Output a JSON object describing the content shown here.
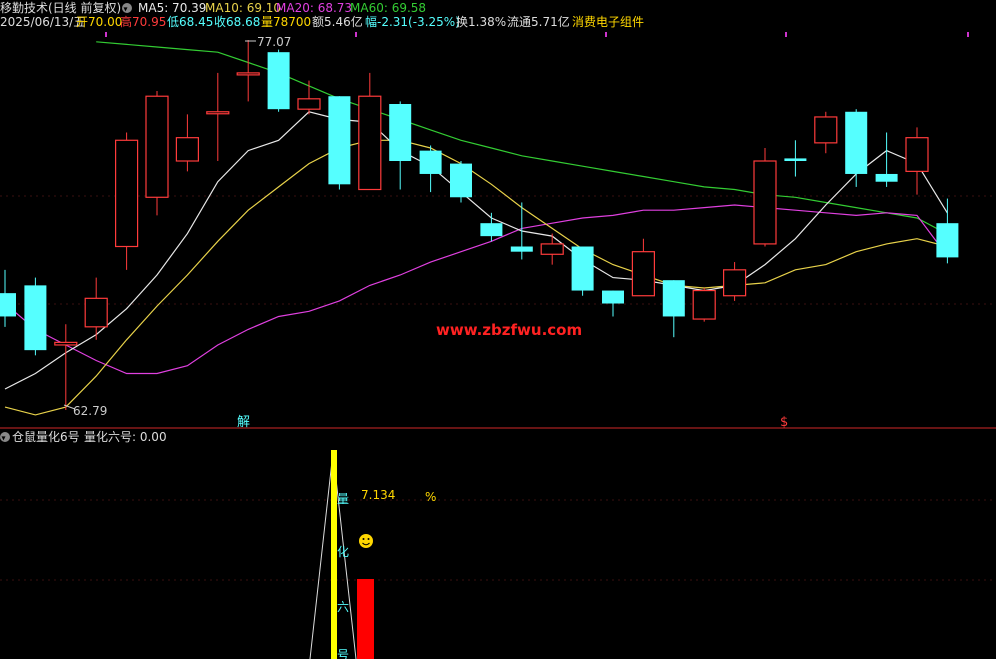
{
  "header": {
    "title": "移勤技术(日线 前复权)",
    "ma5_label": "MA5: 70.39",
    "ma10_label": "MA10: 69.10",
    "ma20_label": "MA20: 68.73",
    "ma60_label": "MA60: 69.58",
    "date": "2025/06/13/五",
    "open": "开70.00",
    "high": "高70.95",
    "low": "低68.45",
    "close": "收68.68",
    "volume": "量78700",
    "amount": "额5.46亿",
    "change": "幅-2.31(-3.25%)",
    "turnover": "换1.38%",
    "float_cap": "流通5.71亿",
    "sector": "消费电子组件"
  },
  "annotations": {
    "high_mark": "77.07",
    "low_mark": "62.79",
    "jie": "解",
    "dollar": "$",
    "watermark": "www.zbzfwu.com"
  },
  "indicator": {
    "title": "仓鼠量化6号",
    "value_label": "量化六号: 0.00",
    "pct_value": "7.134",
    "pct_sign": "%",
    "smiley": "☺",
    "vertical_chars": [
      "量",
      "化",
      "六",
      "号"
    ]
  },
  "colors": {
    "up": "#ff3b3b",
    "down": "#55ffff",
    "ma5": "#e8e8e8",
    "ma10": "#e8d24a",
    "ma20": "#e040e0",
    "ma60": "#33cc33",
    "yellow_text": "#ffd700",
    "red_text": "#ff3b3b",
    "grid": "#7a1c1c"
  },
  "chart_data": {
    "type": "candlestick",
    "candles": [
      {
        "o": 67.3,
        "c": 66.4,
        "h": 68.2,
        "l": 66.0
      },
      {
        "o": 67.6,
        "c": 65.1,
        "h": 67.9,
        "l": 64.9
      },
      {
        "o": 65.3,
        "c": 65.4,
        "h": 66.1,
        "l": 62.79
      },
      {
        "o": 66.0,
        "c": 67.1,
        "h": 67.9,
        "l": 65.5
      },
      {
        "o": 69.1,
        "c": 73.2,
        "h": 73.5,
        "l": 68.2
      },
      {
        "o": 71.0,
        "c": 74.9,
        "h": 75.1,
        "l": 70.3
      },
      {
        "o": 72.4,
        "c": 73.3,
        "h": 74.2,
        "l": 72.0
      },
      {
        "o": 74.3,
        "c": 74.3,
        "h": 75.8,
        "l": 72.4
      },
      {
        "o": 75.8,
        "c": 75.8,
        "h": 77.07,
        "l": 74.7
      },
      {
        "o": 76.6,
        "c": 74.4,
        "h": 76.7,
        "l": 74.3
      },
      {
        "o": 74.4,
        "c": 74.8,
        "h": 75.5,
        "l": 74.2
      },
      {
        "o": 74.9,
        "c": 71.5,
        "h": 74.9,
        "l": 71.3
      },
      {
        "o": 71.3,
        "c": 74.9,
        "h": 75.8,
        "l": 71.3
      },
      {
        "o": 74.6,
        "c": 72.4,
        "h": 74.7,
        "l": 71.3
      },
      {
        "o": 72.8,
        "c": 71.9,
        "h": 73.0,
        "l": 71.2
      },
      {
        "o": 72.3,
        "c": 71.0,
        "h": 72.4,
        "l": 70.8
      },
      {
        "o": 70.0,
        "c": 69.5,
        "h": 70.4,
        "l": 69.3
      },
      {
        "o": 69.1,
        "c": 68.9,
        "h": 70.8,
        "l": 68.6
      },
      {
        "o": 68.8,
        "c": 69.2,
        "h": 69.6,
        "l": 68.4
      },
      {
        "o": 69.1,
        "c": 67.4,
        "h": 69.1,
        "l": 67.2
      },
      {
        "o": 67.4,
        "c": 66.9,
        "h": 67.4,
        "l": 66.4
      },
      {
        "o": 67.2,
        "c": 68.9,
        "h": 69.4,
        "l": 67.2
      },
      {
        "o": 67.8,
        "c": 66.4,
        "h": 67.8,
        "l": 65.6
      },
      {
        "o": 66.3,
        "c": 67.4,
        "h": 67.5,
        "l": 66.2
      },
      {
        "o": 67.2,
        "c": 68.2,
        "h": 68.5,
        "l": 67.0
      },
      {
        "o": 69.2,
        "c": 72.4,
        "h": 72.9,
        "l": 69.1
      },
      {
        "o": 72.5,
        "c": 72.4,
        "h": 73.2,
        "l": 71.8
      },
      {
        "o": 73.1,
        "c": 74.1,
        "h": 74.3,
        "l": 72.7
      },
      {
        "o": 74.3,
        "c": 71.9,
        "h": 74.4,
        "l": 71.4
      },
      {
        "o": 71.9,
        "c": 71.6,
        "h": 73.5,
        "l": 71.4
      },
      {
        "o": 72.0,
        "c": 73.3,
        "h": 73.7,
        "l": 71.1
      },
      {
        "o": 70.0,
        "c": 68.68,
        "h": 70.95,
        "l": 68.45
      }
    ],
    "ma5": [
      63.6,
      64.2,
      65.0,
      65.7,
      66.7,
      68.0,
      69.6,
      71.6,
      72.8,
      73.2,
      74.3,
      74.0,
      73.9,
      72.8,
      72.2,
      71.2,
      70.2,
      69.7,
      69.5,
      68.6,
      67.9,
      67.8,
      67.6,
      67.4,
      67.6,
      68.4,
      69.4,
      70.7,
      71.9,
      72.8,
      72.3,
      70.39
    ],
    "ma10": [
      62.9,
      62.6,
      62.9,
      64.1,
      65.5,
      66.8,
      68.0,
      69.3,
      70.5,
      71.4,
      72.3,
      72.9,
      73.2,
      73.2,
      72.9,
      72.3,
      71.5,
      70.6,
      69.8,
      69.0,
      68.4,
      68.0,
      67.6,
      67.5,
      67.6,
      67.7,
      68.2,
      68.4,
      68.9,
      69.2,
      69.4,
      69.1
    ],
    "ma20": [
      66.9,
      65.9,
      65.3,
      64.7,
      64.2,
      64.2,
      64.5,
      65.3,
      65.9,
      66.4,
      66.6,
      67.0,
      67.6,
      68.0,
      68.5,
      68.9,
      69.3,
      69.8,
      70.0,
      70.2,
      70.3,
      70.5,
      70.5,
      70.6,
      70.7,
      70.6,
      70.5,
      70.4,
      70.3,
      70.4,
      70.3,
      68.73
    ],
    "ma60": [
      null,
      null,
      null,
      77.0,
      76.9,
      76.8,
      76.7,
      76.6,
      76.2,
      75.8,
      75.3,
      74.8,
      74.4,
      74.0,
      73.6,
      73.2,
      72.9,
      72.6,
      72.4,
      72.2,
      72.0,
      71.8,
      71.6,
      71.4,
      71.3,
      71.1,
      71.0,
      70.8,
      70.6,
      70.4,
      70.2,
      69.58
    ],
    "indicator": {
      "name": "量化六号",
      "yellow_bar_index": 11,
      "red_bar_index": 12,
      "red_bar_value": 7.134
    }
  }
}
